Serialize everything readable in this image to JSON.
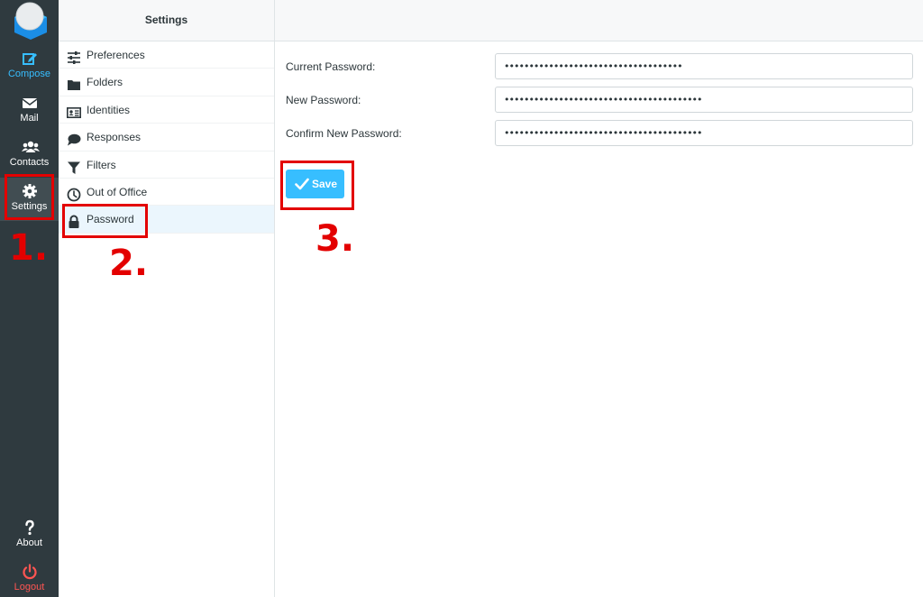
{
  "nav": {
    "compose": "Compose",
    "mail": "Mail",
    "contacts": "Contacts",
    "settings": "Settings",
    "about": "About",
    "logout": "Logout"
  },
  "settings_list": {
    "title": "Settings",
    "items": [
      {
        "label": "Preferences",
        "icon": "sliders-icon"
      },
      {
        "label": "Folders",
        "icon": "folder-icon"
      },
      {
        "label": "Identities",
        "icon": "id-card-icon"
      },
      {
        "label": "Responses",
        "icon": "comment-icon"
      },
      {
        "label": "Filters",
        "icon": "filter-icon"
      },
      {
        "label": "Out of Office",
        "icon": "clock-icon"
      },
      {
        "label": "Password",
        "icon": "lock-icon",
        "selected": true
      }
    ]
  },
  "form": {
    "current_label": "Current Password:",
    "current_value": "••••••••••••••••••••••••••••••••••••",
    "new_label": "New Password:",
    "new_value": "••••••••••••••••••••••••••••••••••••••••",
    "confirm_label": "Confirm New Password:",
    "confirm_value": "••••••••••••••••••••••••••••••••••••••••",
    "save_label": "Save"
  },
  "annotations": {
    "step1": "1.",
    "step2": "2.",
    "step3": "3."
  },
  "colors": {
    "accent": "#37beff",
    "nav_bg": "#2f3a3f",
    "logout": "#ff5552",
    "annotation": "#e30000"
  }
}
